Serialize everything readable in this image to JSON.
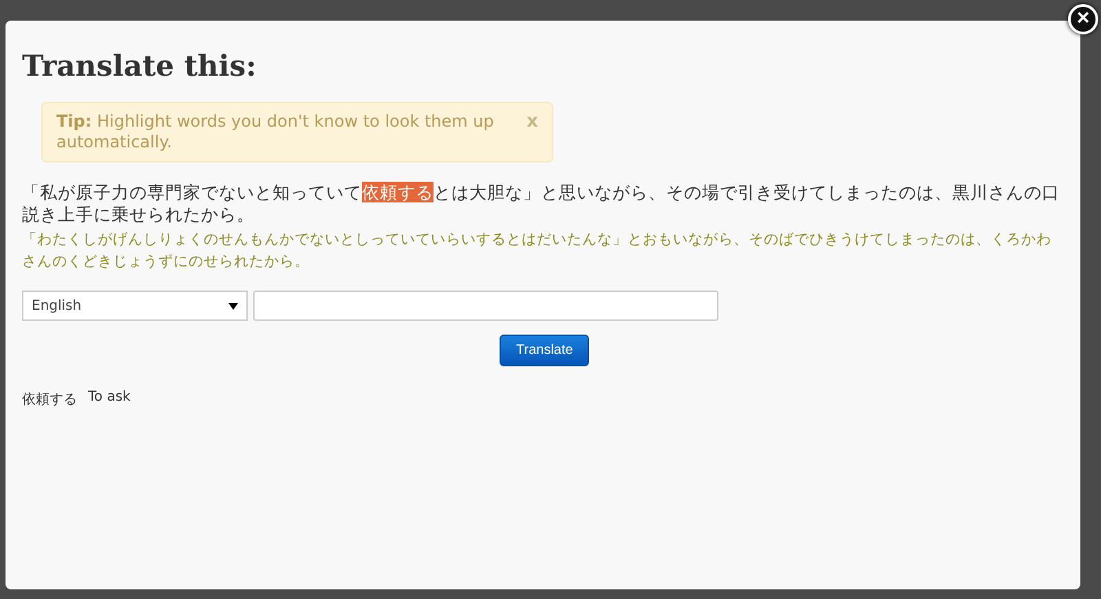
{
  "dialog": {
    "title": "Translate this:",
    "close_symbol": "×"
  },
  "tip": {
    "label": "Tip:",
    "text": "Highlight words you don't know to look them up automatically.",
    "dismiss": "x"
  },
  "sentence": {
    "before": "「私が原子力の専門家でないと知っていて",
    "highlighted": "依頼する",
    "after": "とは大胆な」と思いながら、その場で引き受けてしまったのは、黒川さんの口説き上手に乗せられたから。"
  },
  "reading": "「わたくしがげんしりょくのせんもんかでないとしっていていらいするとはだいたんな」とおもいながら、そのばでひきうけてしまったのは、くろかわさんのくどきじょうずにのせられたから。",
  "language_select": {
    "value": "English"
  },
  "translate_button": "Translate",
  "glossary": [
    {
      "term": "依頼する",
      "meaning": "To ask"
    }
  ]
}
